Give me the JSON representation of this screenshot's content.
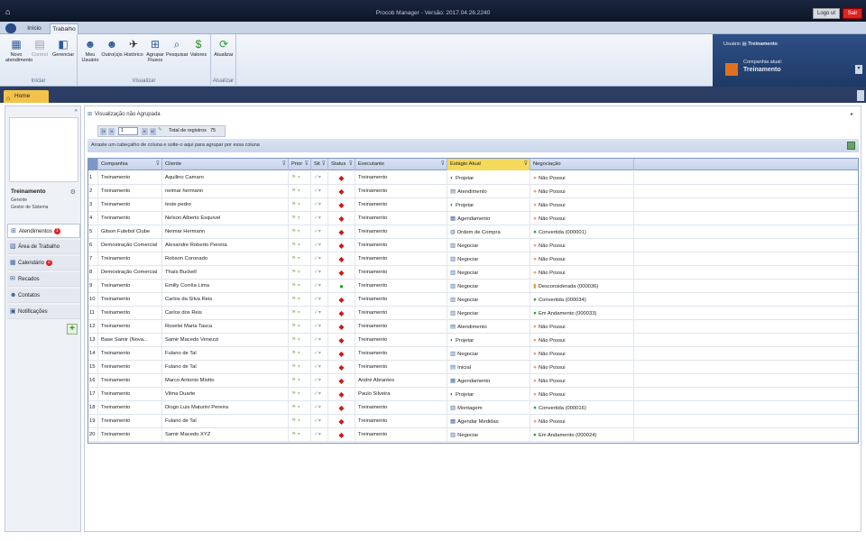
{
  "title": "Procob Manager - Versão: 2017.04.26.2240",
  "titlebar": {
    "logout_label": "Logo ut",
    "exit_label": "Sair"
  },
  "ribbon": {
    "tabs": [
      "Início",
      "Trabalho"
    ],
    "search_placeholder": "Pesquisar...",
    "groups": [
      {
        "label": "Iniciar",
        "buttons": [
          "Novo atendimento",
          "Control",
          "Gerenciar"
        ]
      },
      {
        "label": "Visualizar",
        "buttons": [
          "Meu Usuário",
          "Outro(a)s",
          "Histórico",
          "Agrupar Fluxos",
          "Pesquisar",
          "Valores"
        ]
      },
      {
        "label": "Atualizar",
        "buttons": [
          "Atualizar"
        ]
      }
    ]
  },
  "user_panel": {
    "user_label": "Usuário",
    "user_name": "Treinamento",
    "company_label": "Companhia atual:",
    "company_name": "Treinamento"
  },
  "doc_tab": "Home",
  "sidebar": {
    "name": "Treinamento",
    "roles": [
      "Gerente",
      "Gestor de Sistema"
    ],
    "nav": [
      {
        "label": "Atendimentos",
        "badge": "1"
      },
      {
        "label": "Área de Trabalho",
        "badge": ""
      },
      {
        "label": "Calendário",
        "badge": "2"
      },
      {
        "label": "Recados",
        "badge": ""
      },
      {
        "label": "Contatos",
        "badge": ""
      },
      {
        "label": "Notificações",
        "badge": ""
      }
    ]
  },
  "view": {
    "title": "Visualização não Agrupada",
    "page": "1",
    "total_label": "Total de registros",
    "total": "75",
    "group_hint": "Arraste um cabeçalho de coluna e solte-o aqui para agrupar por essa coluna"
  },
  "columns": [
    "Companhia",
    "Cliente",
    "Prior",
    "Sit",
    "Status",
    "Executante",
    "Estágio Atual",
    "Negociação"
  ],
  "rows": [
    {
      "n": "1",
      "companhia": "Treinamento",
      "cliente": "Aquilino Camaro",
      "status": "r",
      "executante": "Treinamento",
      "estagio": "Projetar",
      "neg": "Não Possui",
      "nc": "r"
    },
    {
      "n": "2",
      "companhia": "Treinamento",
      "cliente": "neimar hermann",
      "status": "r",
      "executante": "Treinamento",
      "estagio": "Atendimento",
      "neg": "Não Possui",
      "nc": "r"
    },
    {
      "n": "3",
      "companhia": "Treinamento",
      "cliente": "teste pedro",
      "status": "r",
      "executante": "Treinamento",
      "estagio": "Projetar",
      "neg": "Não Possui",
      "nc": "r"
    },
    {
      "n": "4",
      "companhia": "Treinamento",
      "cliente": "Nelson Alberto Esquivel",
      "status": "r",
      "executante": "Treinamento",
      "estagio": "Agendamento",
      "neg": "Não Possui",
      "nc": "r"
    },
    {
      "n": "5",
      "companhia": "Gilson Futebol Clube",
      "cliente": "Neimar Hermann",
      "status": "r",
      "executante": "Treinamento",
      "estagio": "Ordem de Compra",
      "neg": "Convertida (000001)",
      "nc": "g"
    },
    {
      "n": "6",
      "companhia": "Demostração Comercial",
      "cliente": "Alexandre Roberto Pereira",
      "status": "r",
      "executante": "Treinamento",
      "estagio": "Negociar",
      "neg": "Não Possui",
      "nc": "r"
    },
    {
      "n": "7",
      "companhia": "Treinamento",
      "cliente": "Robson Coronado",
      "status": "r",
      "executante": "Treinamento",
      "estagio": "Negociar",
      "neg": "Não Possui",
      "nc": "r"
    },
    {
      "n": "8",
      "companhia": "Demostração Comercial",
      "cliente": "Thaís Buckell",
      "status": "r",
      "executante": "Treinamento",
      "estagio": "Negociar",
      "neg": "Não Possui",
      "nc": "r"
    },
    {
      "n": "9",
      "companhia": "Treinamento",
      "cliente": "Emilly Corrêa Lima",
      "status": "g",
      "executante": "Treinamento",
      "estagio": "Negociar",
      "neg": "Desconsiderada (000036)",
      "nc": "y"
    },
    {
      "n": "10",
      "companhia": "Treinamento",
      "cliente": "Carlos da Silva Reis",
      "status": "r",
      "executante": "Treinamento",
      "estagio": "Negociar",
      "neg": "Convertida (000034)",
      "nc": "g"
    },
    {
      "n": "11",
      "companhia": "Treinamento",
      "cliente": "Carlos dos Reis",
      "status": "r",
      "executante": "Treinamento",
      "estagio": "Negociar",
      "neg": "Em Andamento (000033)",
      "nc": "g"
    },
    {
      "n": "12",
      "companhia": "Treinamento",
      "cliente": "Roselei Maria Tasca",
      "status": "r",
      "executante": "Treinamento",
      "estagio": "Atendimento",
      "neg": "Não Possui",
      "nc": "r"
    },
    {
      "n": "13",
      "companhia": "Base Samir (Nova...",
      "cliente": "Samir Macedo Venezzi",
      "status": "r",
      "executante": "Treinamento",
      "estagio": "Projetar",
      "neg": "Não Possui",
      "nc": "r"
    },
    {
      "n": "14",
      "companhia": "Treinamento",
      "cliente": "Fulano de Tal",
      "status": "r",
      "executante": "Treinamento",
      "estagio": "Negociar",
      "neg": "Não Possui",
      "nc": "r"
    },
    {
      "n": "15",
      "companhia": "Treinamento",
      "cliente": "Fulano de Tal",
      "status": "r",
      "executante": "Treinamento",
      "estagio": "Inicial",
      "neg": "Não Possui",
      "nc": "r"
    },
    {
      "n": "16",
      "companhia": "Treinamento",
      "cliente": "Marco Antonio Miotto",
      "status": "r",
      "executante": "André Abrantes",
      "estagio": "Agendamento",
      "neg": "Não Possui",
      "nc": "r"
    },
    {
      "n": "17",
      "companhia": "Treinamento",
      "cliente": "Vilma Duarte",
      "status": "r",
      "executante": "Paulo Silveira",
      "estagio": "Projetar",
      "neg": "Não Possui",
      "nc": "r"
    },
    {
      "n": "18",
      "companhia": "Treinamento",
      "cliente": "Diogo Luis Maturini Pereira",
      "status": "r",
      "executante": "Treinamento",
      "estagio": "Montagem",
      "neg": "Convertida (000016)",
      "nc": "g"
    },
    {
      "n": "19",
      "companhia": "Treinamento",
      "cliente": "Fulano de Tal",
      "status": "r",
      "executante": "Treinamento",
      "estagio": "Agendar Medidas",
      "neg": "Não Possui",
      "nc": "r"
    },
    {
      "n": "20",
      "companhia": "Treinamento",
      "cliente": "Samir Macedo XYZ",
      "status": "r",
      "executante": "Treinamento",
      "estagio": "Negociar",
      "neg": "Em Andamento (000024)",
      "nc": "g"
    }
  ]
}
